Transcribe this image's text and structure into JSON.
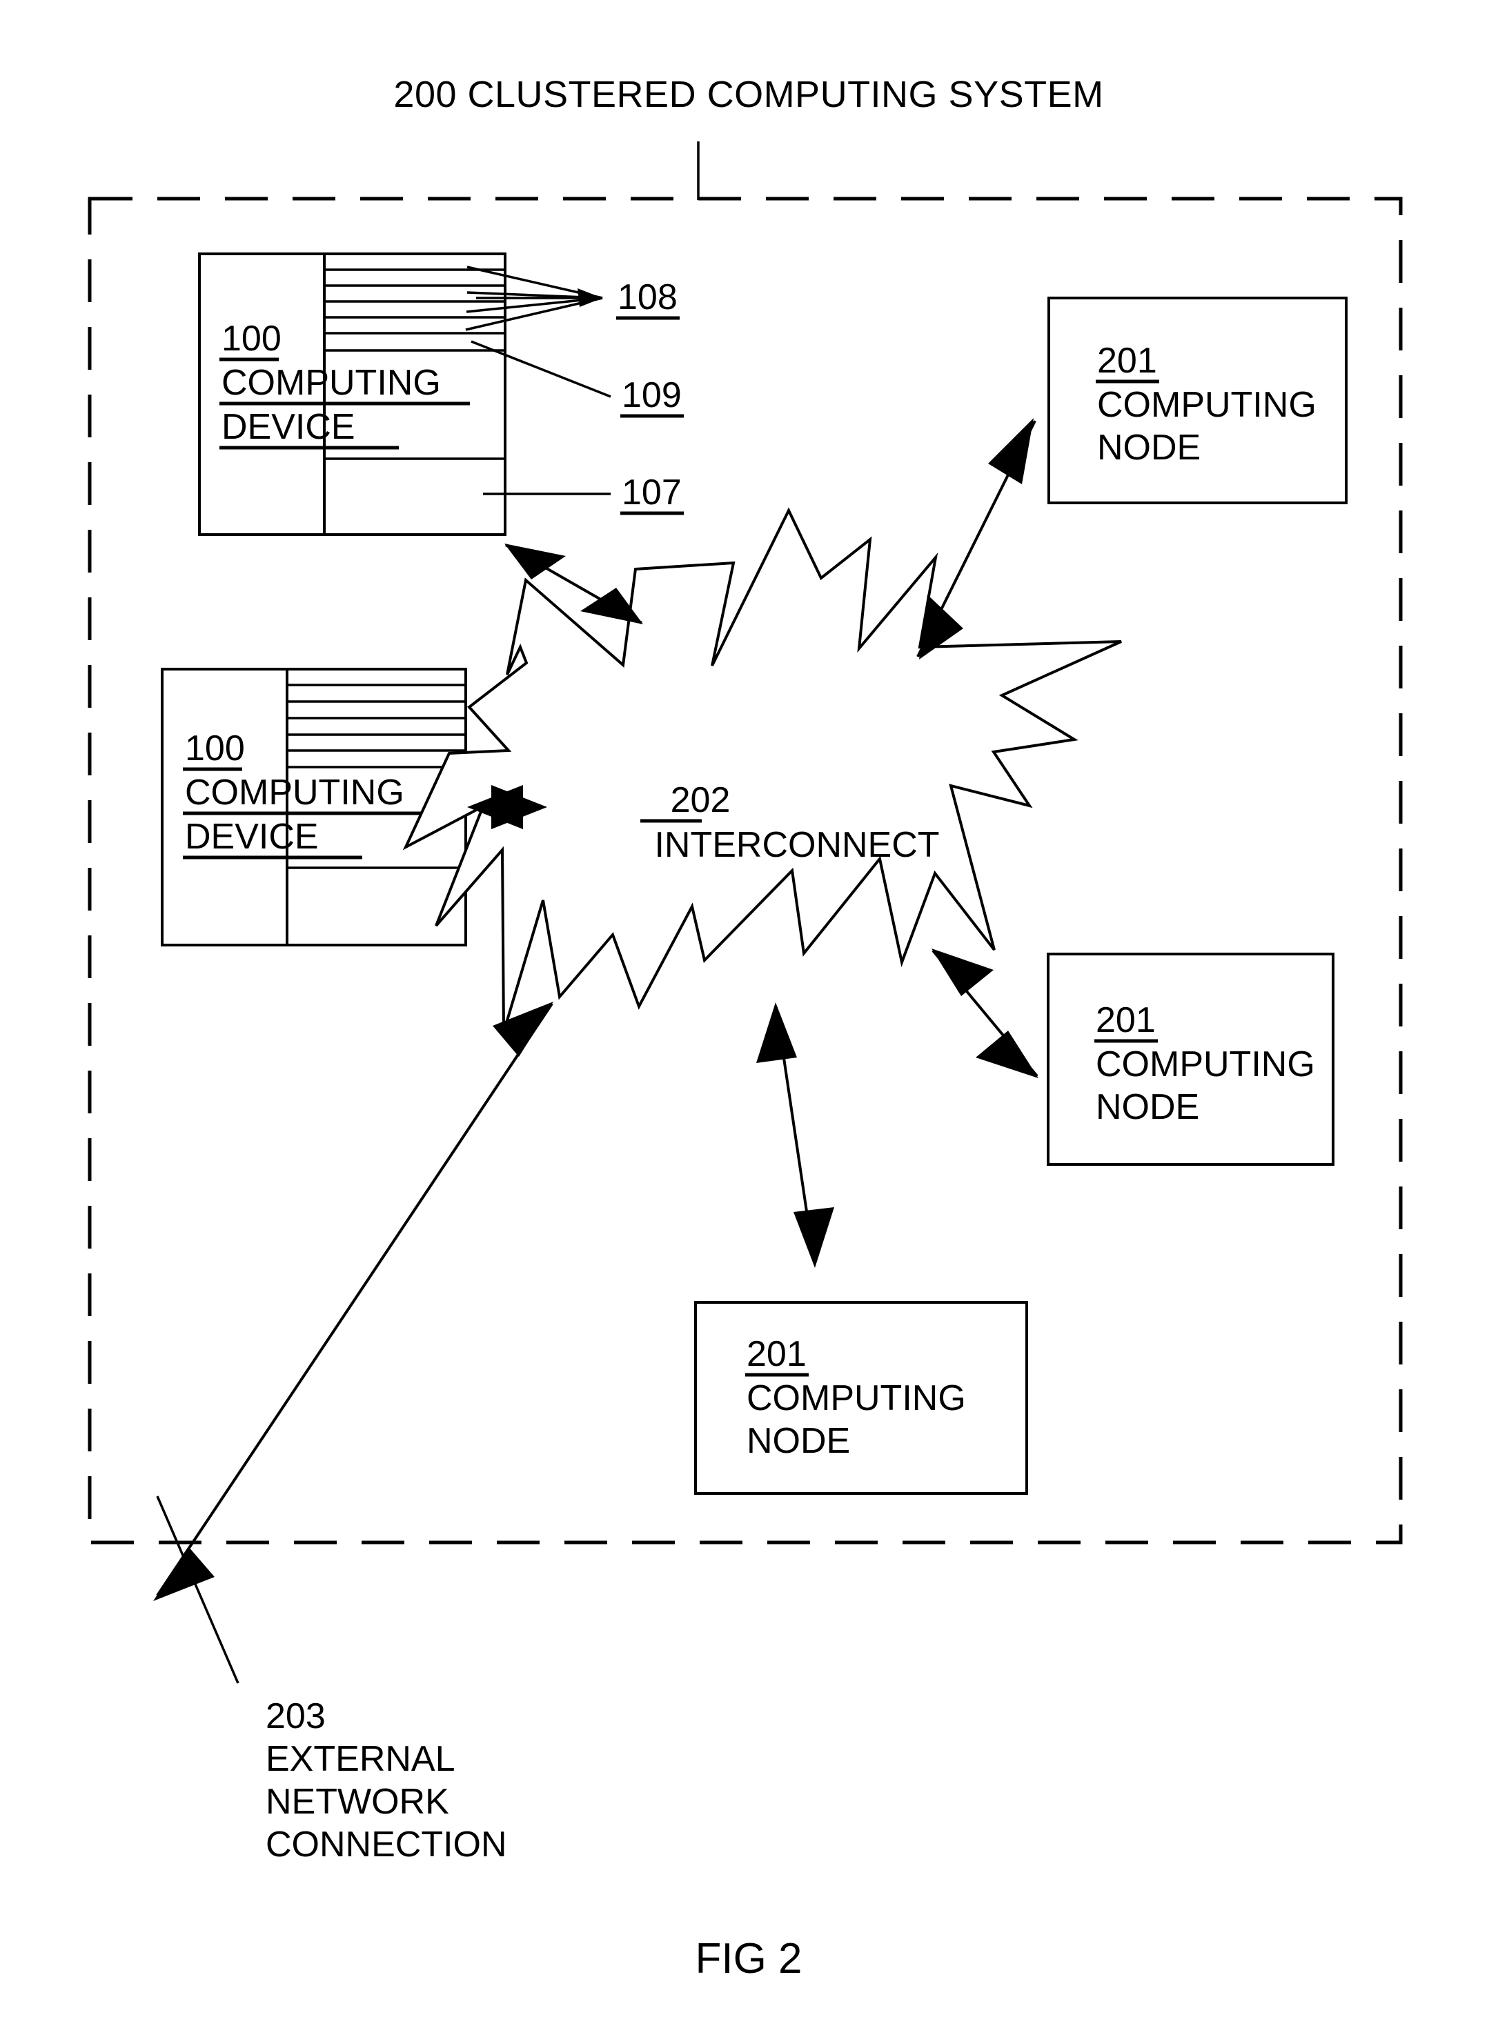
{
  "figure": {
    "label": "FIG 2",
    "title": "200 CLUSTERED COMPUTING SYSTEM",
    "system_ref": "200",
    "system_name": "CLUSTERED COMPUTING SYSTEM"
  },
  "boundary": {
    "name": "clustered-computing-system-boundary",
    "style": "dashed"
  },
  "computing_devices": [
    {
      "ref": "100",
      "name_line1": "COMPUTING",
      "name_line2": "DEVICE",
      "callouts": [
        {
          "ref": "108",
          "underlined": true
        },
        {
          "ref": "109",
          "underlined": true
        },
        {
          "ref": "107",
          "underlined": true
        }
      ]
    },
    {
      "ref": "100",
      "name_line1": "COMPUTING",
      "name_line2": "DEVICE",
      "callouts": []
    }
  ],
  "interconnect": {
    "ref": "202",
    "label": "INTERCONNECT"
  },
  "computing_nodes": [
    {
      "ref": "201",
      "name_line1": "COMPUTING",
      "name_line2": "NODE"
    },
    {
      "ref": "201",
      "name_line1": "COMPUTING",
      "name_line2": "NODE"
    },
    {
      "ref": "201",
      "name_line1": "COMPUTING",
      "name_line2": "NODE"
    }
  ],
  "external_connection": {
    "ref": "203",
    "line1": "EXTERNAL",
    "line2": "NETWORK",
    "line3": "CONNECTION"
  },
  "colors": {
    "ink": "#000000",
    "paper": "#ffffff"
  }
}
